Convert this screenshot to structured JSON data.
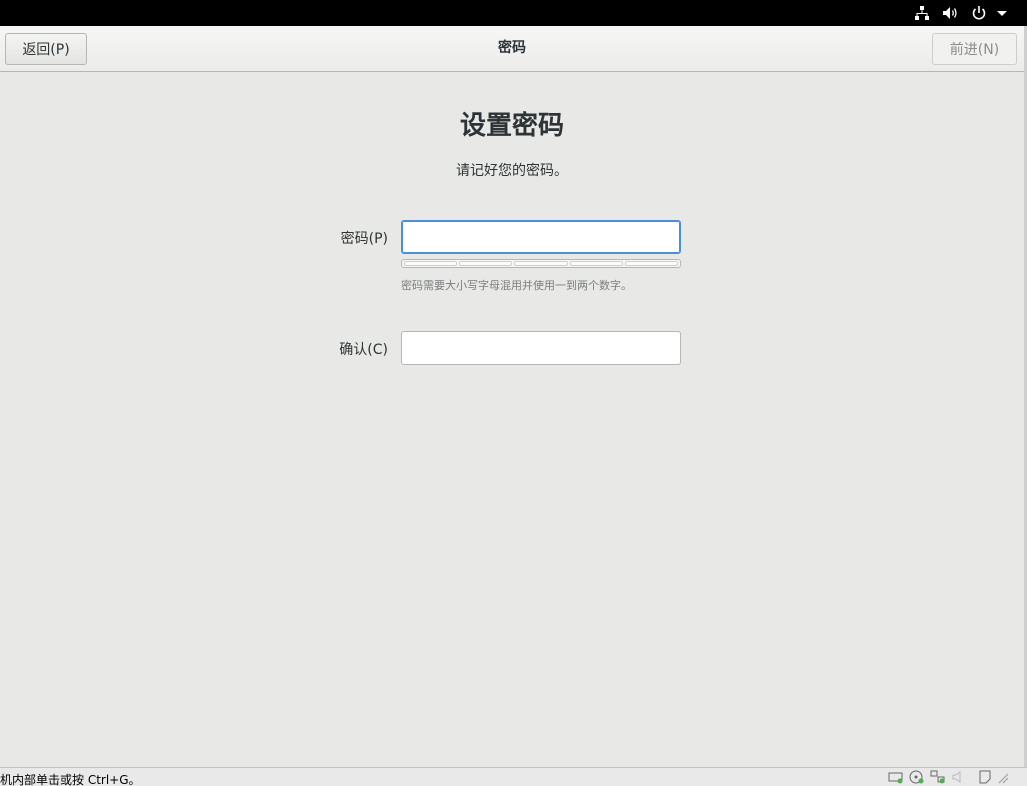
{
  "header": {
    "back_label": "返回(P)",
    "title": "密码",
    "next_label": "前进(N)"
  },
  "main": {
    "heading": "设置密码",
    "subtitle": "请记好您的密码。",
    "password_label": "密码(P)",
    "password_value": "",
    "hint": "密码需要大小写字母混用并使用一到两个数字。",
    "strength_segments": 5,
    "confirm_label": "确认(C)",
    "confirm_value": ""
  },
  "statusbar": {
    "text": "机内部单击或按 Ctrl+G。"
  },
  "icons": {
    "network": "network-icon",
    "volume": "volume-icon",
    "power": "power-icon",
    "menu": "chevron-down-icon"
  }
}
